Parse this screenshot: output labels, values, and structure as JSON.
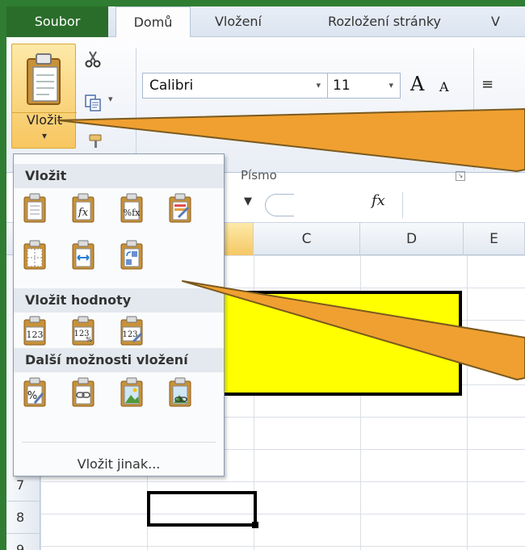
{
  "tabs": {
    "file": "Soubor",
    "home": "Domů",
    "insert": "Vložení",
    "page_layout": "Rozložení stránky",
    "next": "V"
  },
  "ribbon": {
    "paste_label": "Vložit",
    "paste_caret": "▾",
    "font_name": "Calibri",
    "font_size": "11",
    "font_group_label": "Písmo",
    "grow_font": "A",
    "shrink_font": "A"
  },
  "formula_bar": {
    "fx": "fx"
  },
  "columns": [
    "C",
    "D",
    "E"
  ],
  "rows": [
    "7",
    "8",
    "9"
  ],
  "paste_menu": {
    "section_paste": "Vložit",
    "section_values": "Vložit hodnoty",
    "section_other": "Další možnosti vložení",
    "paste_special": "Vložit jinak..."
  },
  "colors": {
    "frame_green": "#2f7d32",
    "callout_orange": "#f0a030",
    "highlight_yellow": "#ffff00"
  }
}
